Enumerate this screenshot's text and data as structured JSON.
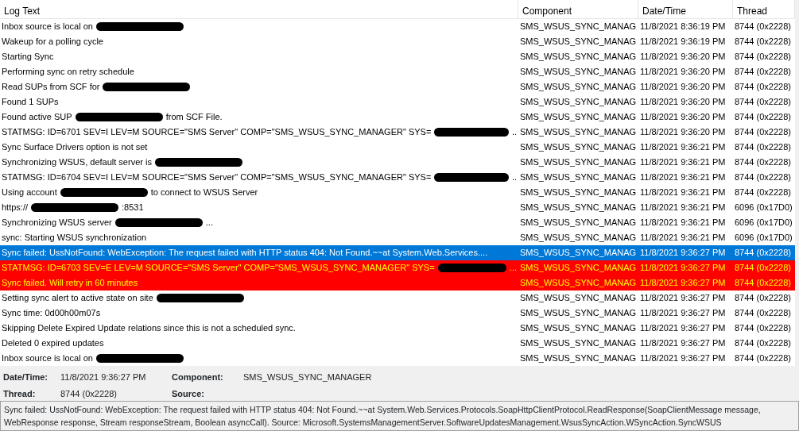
{
  "columns": [
    "Log Text",
    "Component",
    "Date/Time",
    "Thread"
  ],
  "rows": [
    {
      "kind": "normal",
      "selected": false,
      "parts": [
        {
          "kind": "text",
          "text": "Inbox source is local on"
        },
        {
          "kind": "redaction"
        }
      ],
      "component": "SMS_WSUS_SYNC_MANAG",
      "datetime": "11/8/2021 8:36:19 PM",
      "thread": "8744 (0x2228)"
    },
    {
      "kind": "normal",
      "selected": false,
      "parts": [
        {
          "kind": "text",
          "text": "Wakeup for a polling cycle"
        }
      ],
      "component": "SMS_WSUS_SYNC_MANAG",
      "datetime": "11/8/2021 9:36:19 PM",
      "thread": "8744 (0x2228)"
    },
    {
      "kind": "normal",
      "selected": false,
      "parts": [
        {
          "kind": "text",
          "text": "Starting Sync"
        }
      ],
      "component": "SMS_WSUS_SYNC_MANAG",
      "datetime": "11/8/2021 9:36:20 PM",
      "thread": "8744 (0x2228)"
    },
    {
      "kind": "normal",
      "selected": false,
      "parts": [
        {
          "kind": "text",
          "text": "Performing sync on retry schedule"
        }
      ],
      "component": "SMS_WSUS_SYNC_MANAG",
      "datetime": "11/8/2021 9:36:20 PM",
      "thread": "8744 (0x2228)"
    },
    {
      "kind": "normal",
      "selected": false,
      "parts": [
        {
          "kind": "text",
          "text": "Read SUPs from SCF for"
        },
        {
          "kind": "redaction"
        }
      ],
      "component": "SMS_WSUS_SYNC_MANAG",
      "datetime": "11/8/2021 9:36:20 PM",
      "thread": "8744 (0x2228)"
    },
    {
      "kind": "normal",
      "selected": false,
      "parts": [
        {
          "kind": "text",
          "text": "Found 1 SUPs"
        }
      ],
      "component": "SMS_WSUS_SYNC_MANAG",
      "datetime": "11/8/2021 9:36:20 PM",
      "thread": "8744 (0x2228)"
    },
    {
      "kind": "normal",
      "selected": false,
      "parts": [
        {
          "kind": "text",
          "text": "Found active SUP"
        },
        {
          "kind": "redaction"
        },
        {
          "kind": "text",
          "text": "from SCF File."
        }
      ],
      "component": "SMS_WSUS_SYNC_MANAG",
      "datetime": "11/8/2021 9:36:20 PM",
      "thread": "8744 (0x2228)"
    },
    {
      "kind": "normal",
      "selected": false,
      "parts": [
        {
          "kind": "text",
          "text": "STATMSG: ID=6701 SEV=I LEV=M SOURCE=\"SMS Server\" COMP=\"SMS_WSUS_SYNC_MANAGER\" SYS="
        },
        {
          "kind": "redaction"
        },
        {
          "kind": "text",
          "text": ".."
        }
      ],
      "component": "SMS_WSUS_SYNC_MANAG",
      "datetime": "11/8/2021 9:36:20 PM",
      "thread": "8744 (0x2228)"
    },
    {
      "kind": "normal",
      "selected": false,
      "parts": [
        {
          "kind": "text",
          "text": "Sync Surface Drivers option is not set"
        }
      ],
      "component": "SMS_WSUS_SYNC_MANAG",
      "datetime": "11/8/2021 9:36:21 PM",
      "thread": "8744 (0x2228)"
    },
    {
      "kind": "normal",
      "selected": false,
      "parts": [
        {
          "kind": "text",
          "text": "Synchronizing WSUS, default server is"
        },
        {
          "kind": "redaction"
        }
      ],
      "component": "SMS_WSUS_SYNC_MANAG",
      "datetime": "11/8/2021 9:36:21 PM",
      "thread": "8744 (0x2228)"
    },
    {
      "kind": "normal",
      "selected": false,
      "parts": [
        {
          "kind": "text",
          "text": "STATMSG: ID=6704 SEV=I LEV=M SOURCE=\"SMS Server\" COMP=\"SMS_WSUS_SYNC_MANAGER\" SYS="
        },
        {
          "kind": "redaction"
        },
        {
          "kind": "text",
          "text": ".."
        }
      ],
      "component": "SMS_WSUS_SYNC_MANAG",
      "datetime": "11/8/2021 9:36:21 PM",
      "thread": "8744 (0x2228)"
    },
    {
      "kind": "normal",
      "selected": false,
      "parts": [
        {
          "kind": "text",
          "text": "Using account"
        },
        {
          "kind": "redaction"
        },
        {
          "kind": "text",
          "text": "to connect to WSUS Server"
        }
      ],
      "component": "SMS_WSUS_SYNC_MANAG",
      "datetime": "11/8/2021 9:36:21 PM",
      "thread": "8744 (0x2228)"
    },
    {
      "kind": "normal",
      "selected": false,
      "parts": [
        {
          "kind": "text",
          "text": "https://"
        },
        {
          "kind": "redaction"
        },
        {
          "kind": "text",
          "text": ":8531"
        }
      ],
      "component": "SMS_WSUS_SYNC_MANAG",
      "datetime": "11/8/2021 9:36:21 PM",
      "thread": "6096 (0x17D0)"
    },
    {
      "kind": "normal",
      "selected": false,
      "parts": [
        {
          "kind": "text",
          "text": "Synchronizing WSUS server"
        },
        {
          "kind": "redaction"
        },
        {
          "kind": "text",
          "text": "..."
        }
      ],
      "component": "SMS_WSUS_SYNC_MANAG",
      "datetime": "11/8/2021 9:36:21 PM",
      "thread": "6096 (0x17D0)"
    },
    {
      "kind": "normal",
      "selected": false,
      "parts": [
        {
          "kind": "text",
          "text": "sync: Starting WSUS synchronization"
        }
      ],
      "component": "SMS_WSUS_SYNC_MANAG",
      "datetime": "11/8/2021 9:36:21 PM",
      "thread": "6096 (0x17D0)"
    },
    {
      "kind": "normal",
      "selected": true,
      "parts": [
        {
          "kind": "text",
          "text": "Sync failed: UssNotFound: WebException: The request failed with HTTP status 404: Not Found.~~at System.Web.Services...."
        }
      ],
      "component": "SMS_WSUS_SYNC_MANAG",
      "datetime": "11/8/2021 9:36:27 PM",
      "thread": "8744 (0x2228)"
    },
    {
      "kind": "error",
      "selected": false,
      "parts": [
        {
          "kind": "text",
          "text": "STATMSG: ID=6703 SEV=E LEV=M SOURCE=\"SMS Server\" COMP=\"SMS_WSUS_SYNC_MANAGER\" SYS="
        },
        {
          "kind": "redaction"
        },
        {
          "kind": "text",
          "text": "..."
        }
      ],
      "component": "SMS_WSUS_SYNC_MANAG",
      "datetime": "11/8/2021 9:36:27 PM",
      "thread": "8744 (0x2228)"
    },
    {
      "kind": "error",
      "selected": false,
      "parts": [
        {
          "kind": "text",
          "text": "Sync failed. Will retry in 60 minutes"
        }
      ],
      "component": "SMS_WSUS_SYNC_MANAG",
      "datetime": "11/8/2021 9:36:27 PM",
      "thread": "8744 (0x2228)"
    },
    {
      "kind": "normal",
      "selected": false,
      "parts": [
        {
          "kind": "text",
          "text": "Setting sync alert to active state on site"
        },
        {
          "kind": "redaction"
        }
      ],
      "component": "SMS_WSUS_SYNC_MANAG",
      "datetime": "11/8/2021 9:36:27 PM",
      "thread": "8744 (0x2228)"
    },
    {
      "kind": "normal",
      "selected": false,
      "parts": [
        {
          "kind": "text",
          "text": "Sync time: 0d00h00m07s"
        }
      ],
      "component": "SMS_WSUS_SYNC_MANAG",
      "datetime": "11/8/2021 9:36:27 PM",
      "thread": "8744 (0x2228)"
    },
    {
      "kind": "normal",
      "selected": false,
      "parts": [
        {
          "kind": "text",
          "text": "Skipping Delete Expired Update relations since this is not a scheduled sync."
        }
      ],
      "component": "SMS_WSUS_SYNC_MANAG",
      "datetime": "11/8/2021 9:36:27 PM",
      "thread": "8744 (0x2228)"
    },
    {
      "kind": "normal",
      "selected": false,
      "parts": [
        {
          "kind": "text",
          "text": "Deleted 0 expired updates"
        }
      ],
      "component": "SMS_WSUS_SYNC_MANAG",
      "datetime": "11/8/2021 9:36:27 PM",
      "thread": "8744 (0x2228)"
    },
    {
      "kind": "normal",
      "selected": false,
      "parts": [
        {
          "kind": "text",
          "text": "Inbox source is local on"
        },
        {
          "kind": "redaction"
        }
      ],
      "component": "SMS_WSUS_SYNC_MANAG",
      "datetime": "11/8/2021 9:36:27 PM",
      "thread": "8744 (0x2228)"
    }
  ],
  "details": {
    "fields": [
      {
        "label": "Date/Time:",
        "value": "11/8/2021 9:36:27 PM"
      },
      {
        "label": "Component:",
        "value": "SMS_WSUS_SYNC_MANAGER"
      },
      {
        "label": "Thread:",
        "value": "8744 (0x2228)"
      },
      {
        "label": "Source:"
      }
    ],
    "message": "Sync failed: UssNotFound: WebException: The request failed with HTTP status 404: Not Found.~~at System.Web.Services.Protocols.SoapHttpClientProtocol.ReadResponse(SoapClientMessage message, WebResponse response, Stream responseStream, Boolean asyncCall). Source: Microsoft.SystemsManagementServer.SoftwareUpdatesManagement.WsusSyncAction.WSyncAction.SyncWSUS"
  }
}
